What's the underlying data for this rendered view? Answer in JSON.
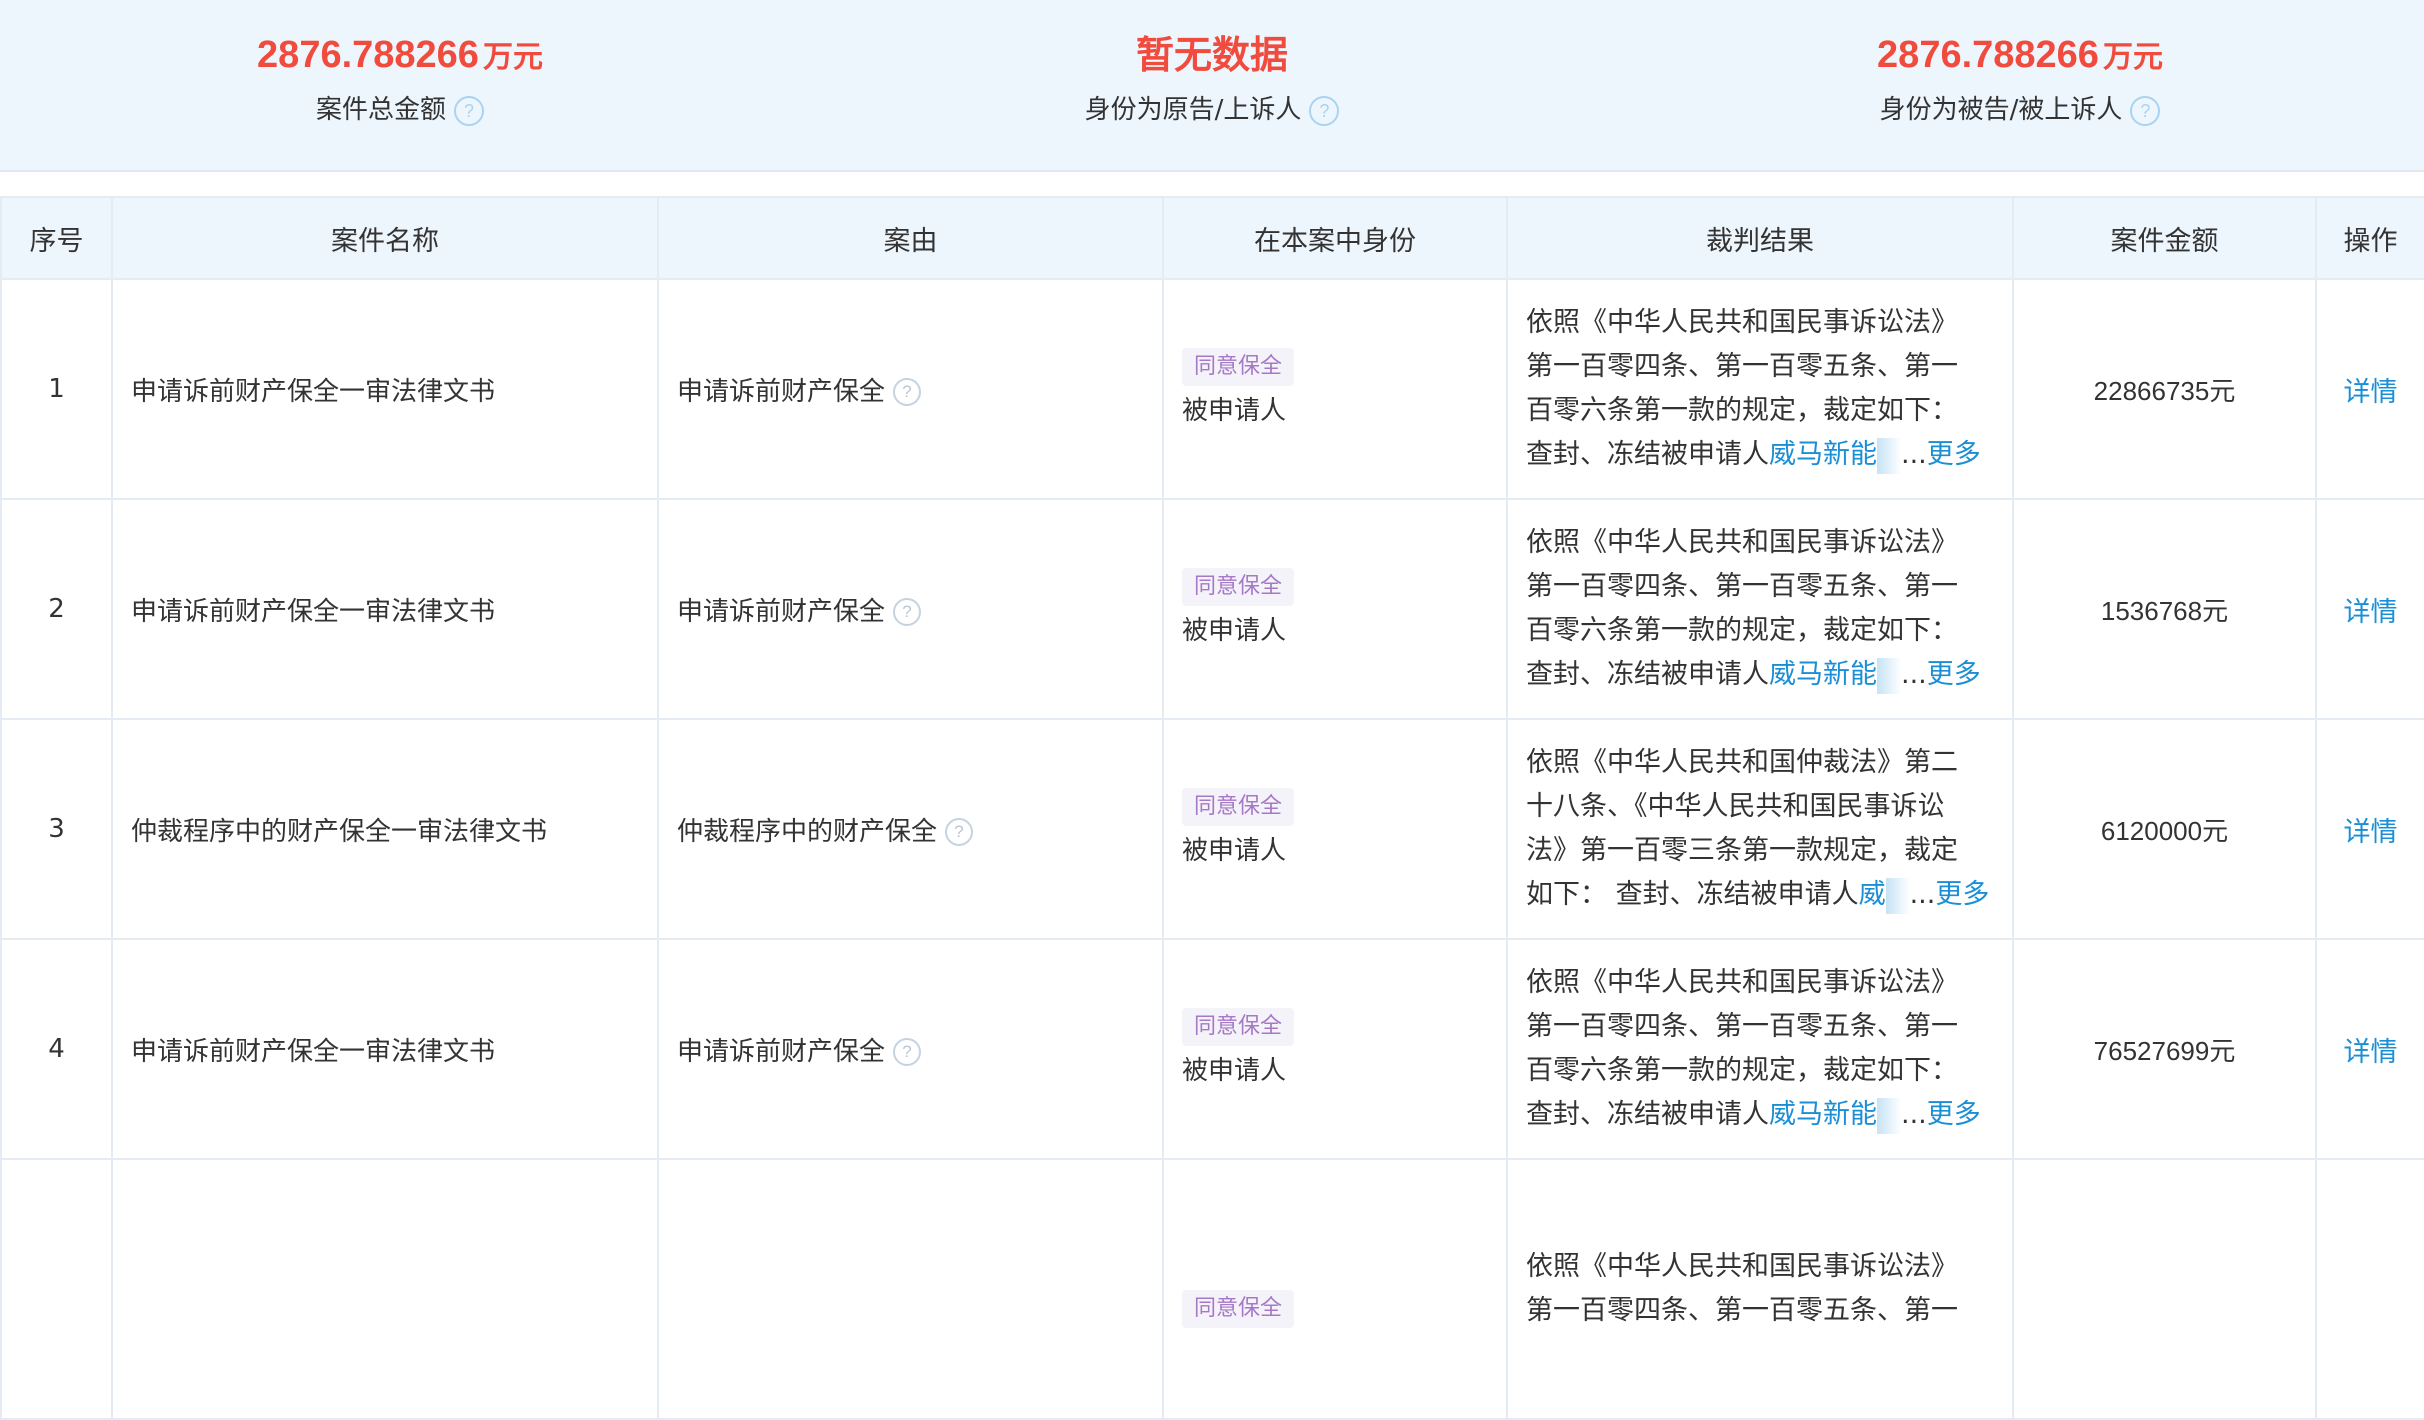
{
  "summary": {
    "total": {
      "value": "2876.788266",
      "unit": "万元",
      "label": "案件总金额"
    },
    "plaintiff": {
      "value": "暂无数据",
      "label": "身份为原告/上诉人"
    },
    "defendant": {
      "value": "2876.788266",
      "unit": "万元",
      "label": "身份为被告/被上诉人"
    },
    "help_glyph": "?"
  },
  "table": {
    "headers": {
      "index": "序号",
      "name": "案件名称",
      "cause": "案由",
      "role": "在本案中身份",
      "result": "裁判结果",
      "amount": "案件金额",
      "action": "操作"
    },
    "rows": [
      {
        "index": "1",
        "name": "申请诉前财产保全一审法律文书",
        "cause": "申请诉前财产保全",
        "badge": "同意保全",
        "role": "被申请人",
        "result_lines": [
          "依照《中华人民共和国民事诉讼法》",
          "第一百零四条、第一百零五条、第一",
          "百零六条第一款的规定，裁定如下："
        ],
        "result_last": "查封、冻结被申请人",
        "result_entity": "威马新能",
        "ellipsis": "...",
        "more": "更多",
        "amount": "22866735元",
        "action": "详情"
      },
      {
        "index": "2",
        "name": "申请诉前财产保全一审法律文书",
        "cause": "申请诉前财产保全",
        "badge": "同意保全",
        "role": "被申请人",
        "result_lines": [
          "依照《中华人民共和国民事诉讼法》",
          "第一百零四条、第一百零五条、第一",
          "百零六条第一款的规定，裁定如下："
        ],
        "result_last": "查封、冻结被申请人",
        "result_entity": "威马新能",
        "ellipsis": "...",
        "more": "更多",
        "amount": "1536768元",
        "action": "详情"
      },
      {
        "index": "3",
        "name": "仲裁程序中的财产保全一审法律文书",
        "cause": "仲裁程序中的财产保全",
        "badge": "同意保全",
        "role": "被申请人",
        "result_lines": [
          "依照《中华人民共和国仲裁法》第二",
          "十八条、《中华人民共和国民事诉讼",
          "法》第一百零三条第一款规定，裁定"
        ],
        "result_last": "如下：  查封、冻结被申请人",
        "result_entity": "威",
        "ellipsis": "...",
        "more": "更多",
        "amount": "6120000元",
        "action": "详情"
      },
      {
        "index": "4",
        "name": "申请诉前财产保全一审法律文书",
        "cause": "申请诉前财产保全",
        "badge": "同意保全",
        "role": "被申请人",
        "result_lines": [
          "依照《中华人民共和国民事诉讼法》",
          "第一百零四条、第一百零五条、第一",
          "百零六条第一款的规定，裁定如下："
        ],
        "result_last": "查封、冻结被申请人",
        "result_entity": "威马新能",
        "ellipsis": "...",
        "more": "更多",
        "amount": "76527699元",
        "action": "详情"
      }
    ],
    "partial_row": {
      "badge": "同意保全",
      "result_lines": [
        "依照《中华人民共和国民事诉讼法》",
        "第一百零四条、第一百零五条、第一"
      ]
    }
  },
  "colors": {
    "accent_red": "#f04b3d",
    "link_blue": "#1a8fd6",
    "badge_purple": "#a679c7",
    "header_bg": "#eef6fd"
  }
}
